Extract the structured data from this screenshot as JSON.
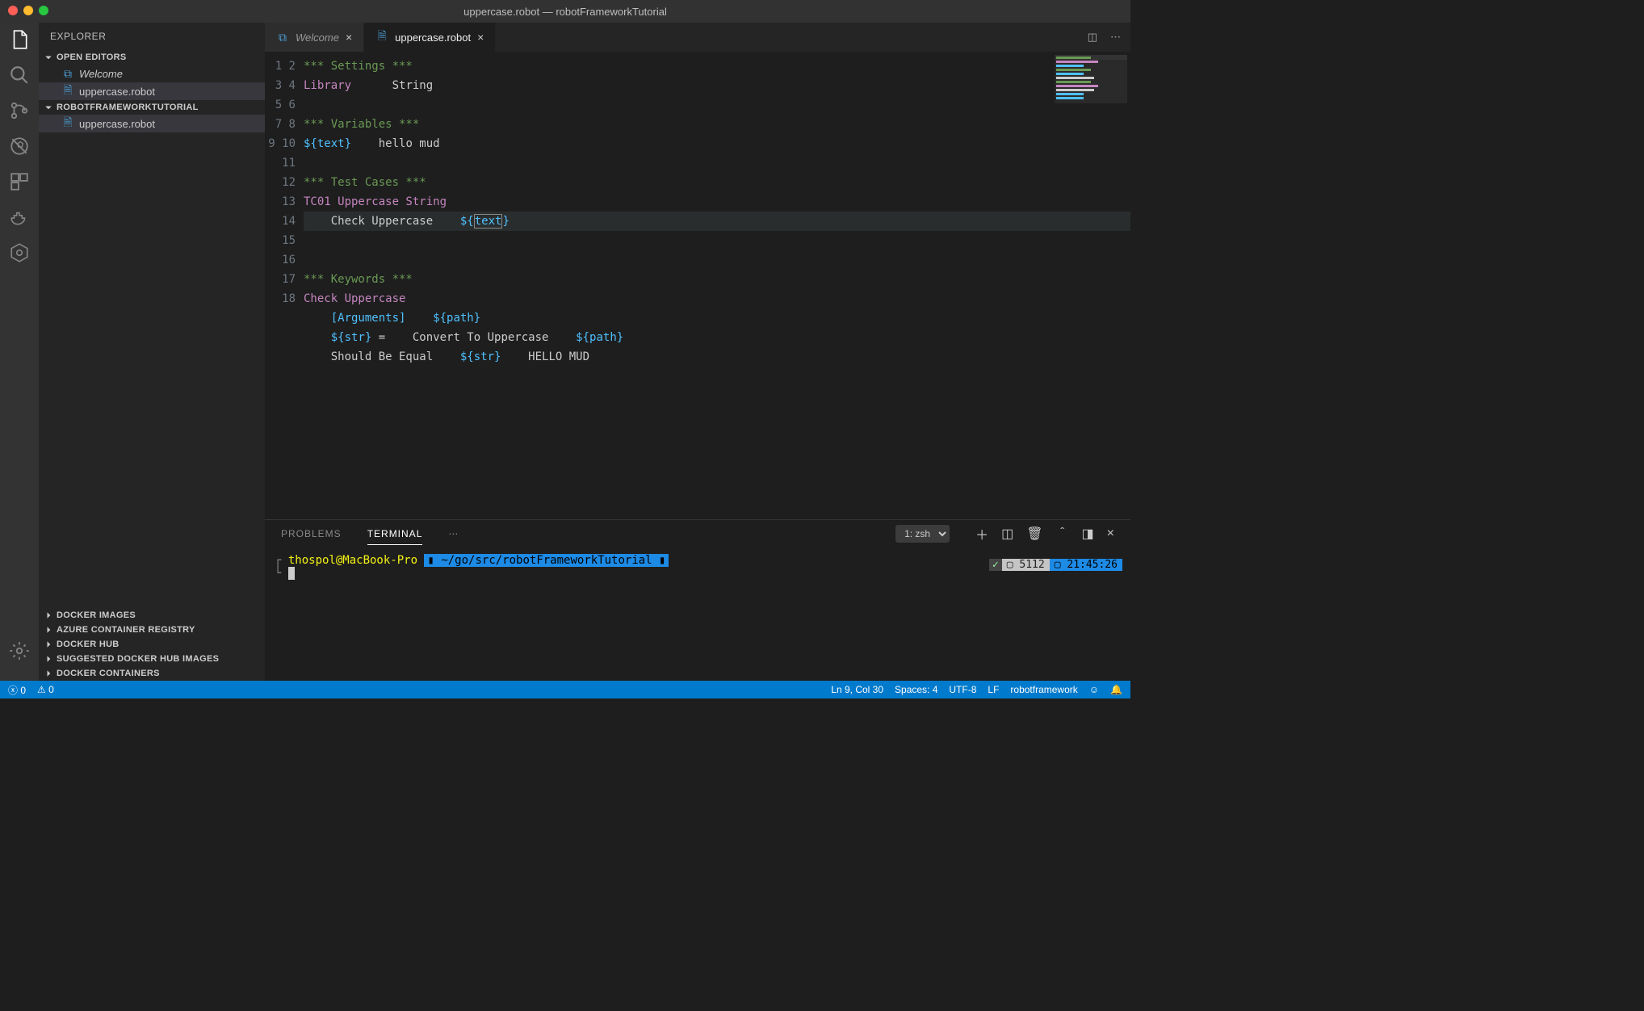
{
  "window": {
    "title": "uppercase.robot — robotFrameworkTutorial"
  },
  "sidebar": {
    "title": "EXPLORER",
    "open_editors": "OPEN EDITORS",
    "workspace": "ROBOTFRAMEWORKTUTORIAL",
    "welcome": "Welcome",
    "file": "uppercase.robot",
    "bottom": [
      "DOCKER IMAGES",
      "AZURE CONTAINER REGISTRY",
      "DOCKER HUB",
      "SUGGESTED DOCKER HUB IMAGES",
      "DOCKER CONTAINERS"
    ]
  },
  "tabs": {
    "t0": "Welcome",
    "t1": "uppercase.robot"
  },
  "code": {
    "l1a": "*** Settings ***",
    "l2a": "Library",
    "l2b": "String",
    "l4": "*** Variables ***",
    "l5a": "${text}",
    "l5b": "hello mud",
    "l7": "*** Test Cases ***",
    "l8": "TC01 Uppercase String",
    "l9a": "Check Uppercase",
    "l9b": "${",
    "l9c": "text",
    "l9d": "}",
    "l12": "*** Keywords ***",
    "l13": "Check Uppercase",
    "l14a": "[Arguments]",
    "l14b": "${path}",
    "l15a": "${str}",
    "l15b": " =",
    "l15c": "Convert To Uppercase",
    "l15d": "${path}",
    "l16a": "Should Be Equal",
    "l16b": "${str}",
    "l16c": "HELLO MUD"
  },
  "panel": {
    "problems": "PROBLEMS",
    "terminal": "TERMINAL",
    "shell": "1: zsh",
    "prompt_user": "thospol@MacBook-Pro",
    "prompt_path": "~/go/src/robotFrameworkTutorial",
    "right_num": "5112",
    "right_time": "21:45:26"
  },
  "status": {
    "err": "0",
    "warn": "0",
    "ln": "Ln 9, Col 30",
    "spaces": "Spaces: 4",
    "enc": "UTF-8",
    "eol": "LF",
    "lang": "robotframework"
  }
}
